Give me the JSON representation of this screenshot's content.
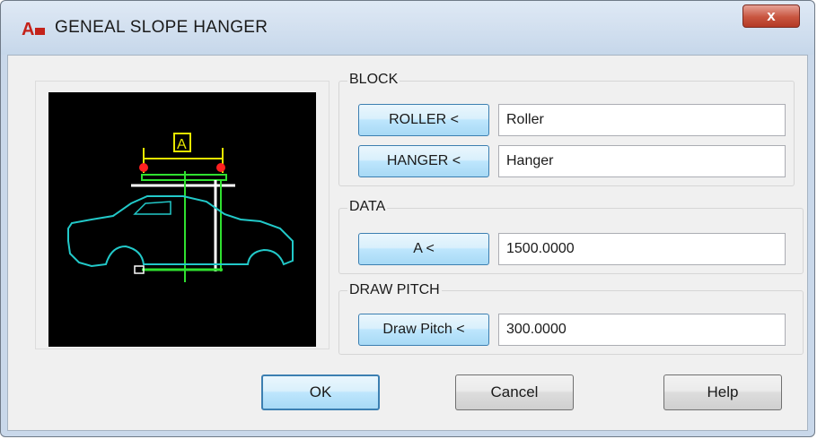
{
  "window": {
    "title": "GENEAL SLOPE HANGER",
    "app_icon_text": "A",
    "close_label": "x"
  },
  "preview": {
    "dimension_label": "A"
  },
  "block": {
    "label": "BLOCK",
    "roller_button": "ROLLER <",
    "roller_value": "Roller",
    "hanger_button": "HANGER <",
    "hanger_value": "Hanger"
  },
  "data_group": {
    "label": "DATA",
    "a_button": "A <",
    "a_value": "1500.0000"
  },
  "draw_pitch": {
    "label": "DRAW PITCH",
    "button": "Draw Pitch <",
    "value": "300.0000"
  },
  "buttons": {
    "ok": "OK",
    "cancel": "Cancel",
    "help": "Help"
  }
}
